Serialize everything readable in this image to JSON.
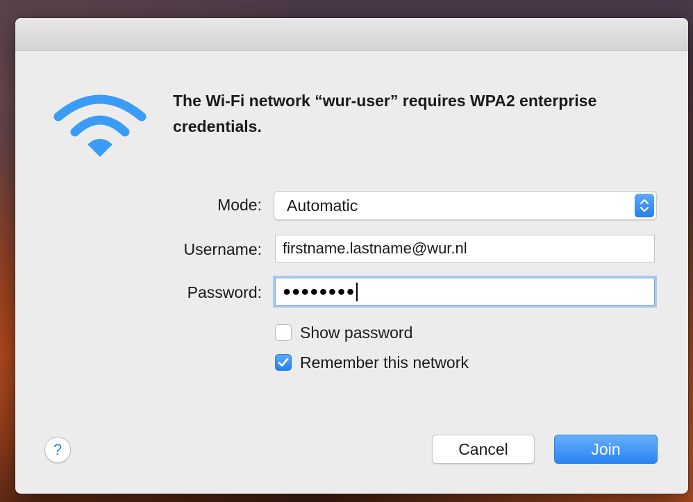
{
  "dialog": {
    "heading": "The Wi-Fi network “wur-user” requires WPA2 enterprise credentials.",
    "wifi_icon": "wifi-icon",
    "accent_color": "#2a85f4"
  },
  "form": {
    "mode_label": "Mode:",
    "mode_value": "Automatic",
    "username_label": "Username:",
    "username_value": "firstname.lastname@wur.nl",
    "password_label": "Password:",
    "password_masked": "●●●●●●●●",
    "show_password_label": "Show password",
    "show_password_checked": false,
    "remember_label": "Remember this network",
    "remember_checked": true
  },
  "buttons": {
    "help": "?",
    "cancel": "Cancel",
    "join": "Join"
  }
}
